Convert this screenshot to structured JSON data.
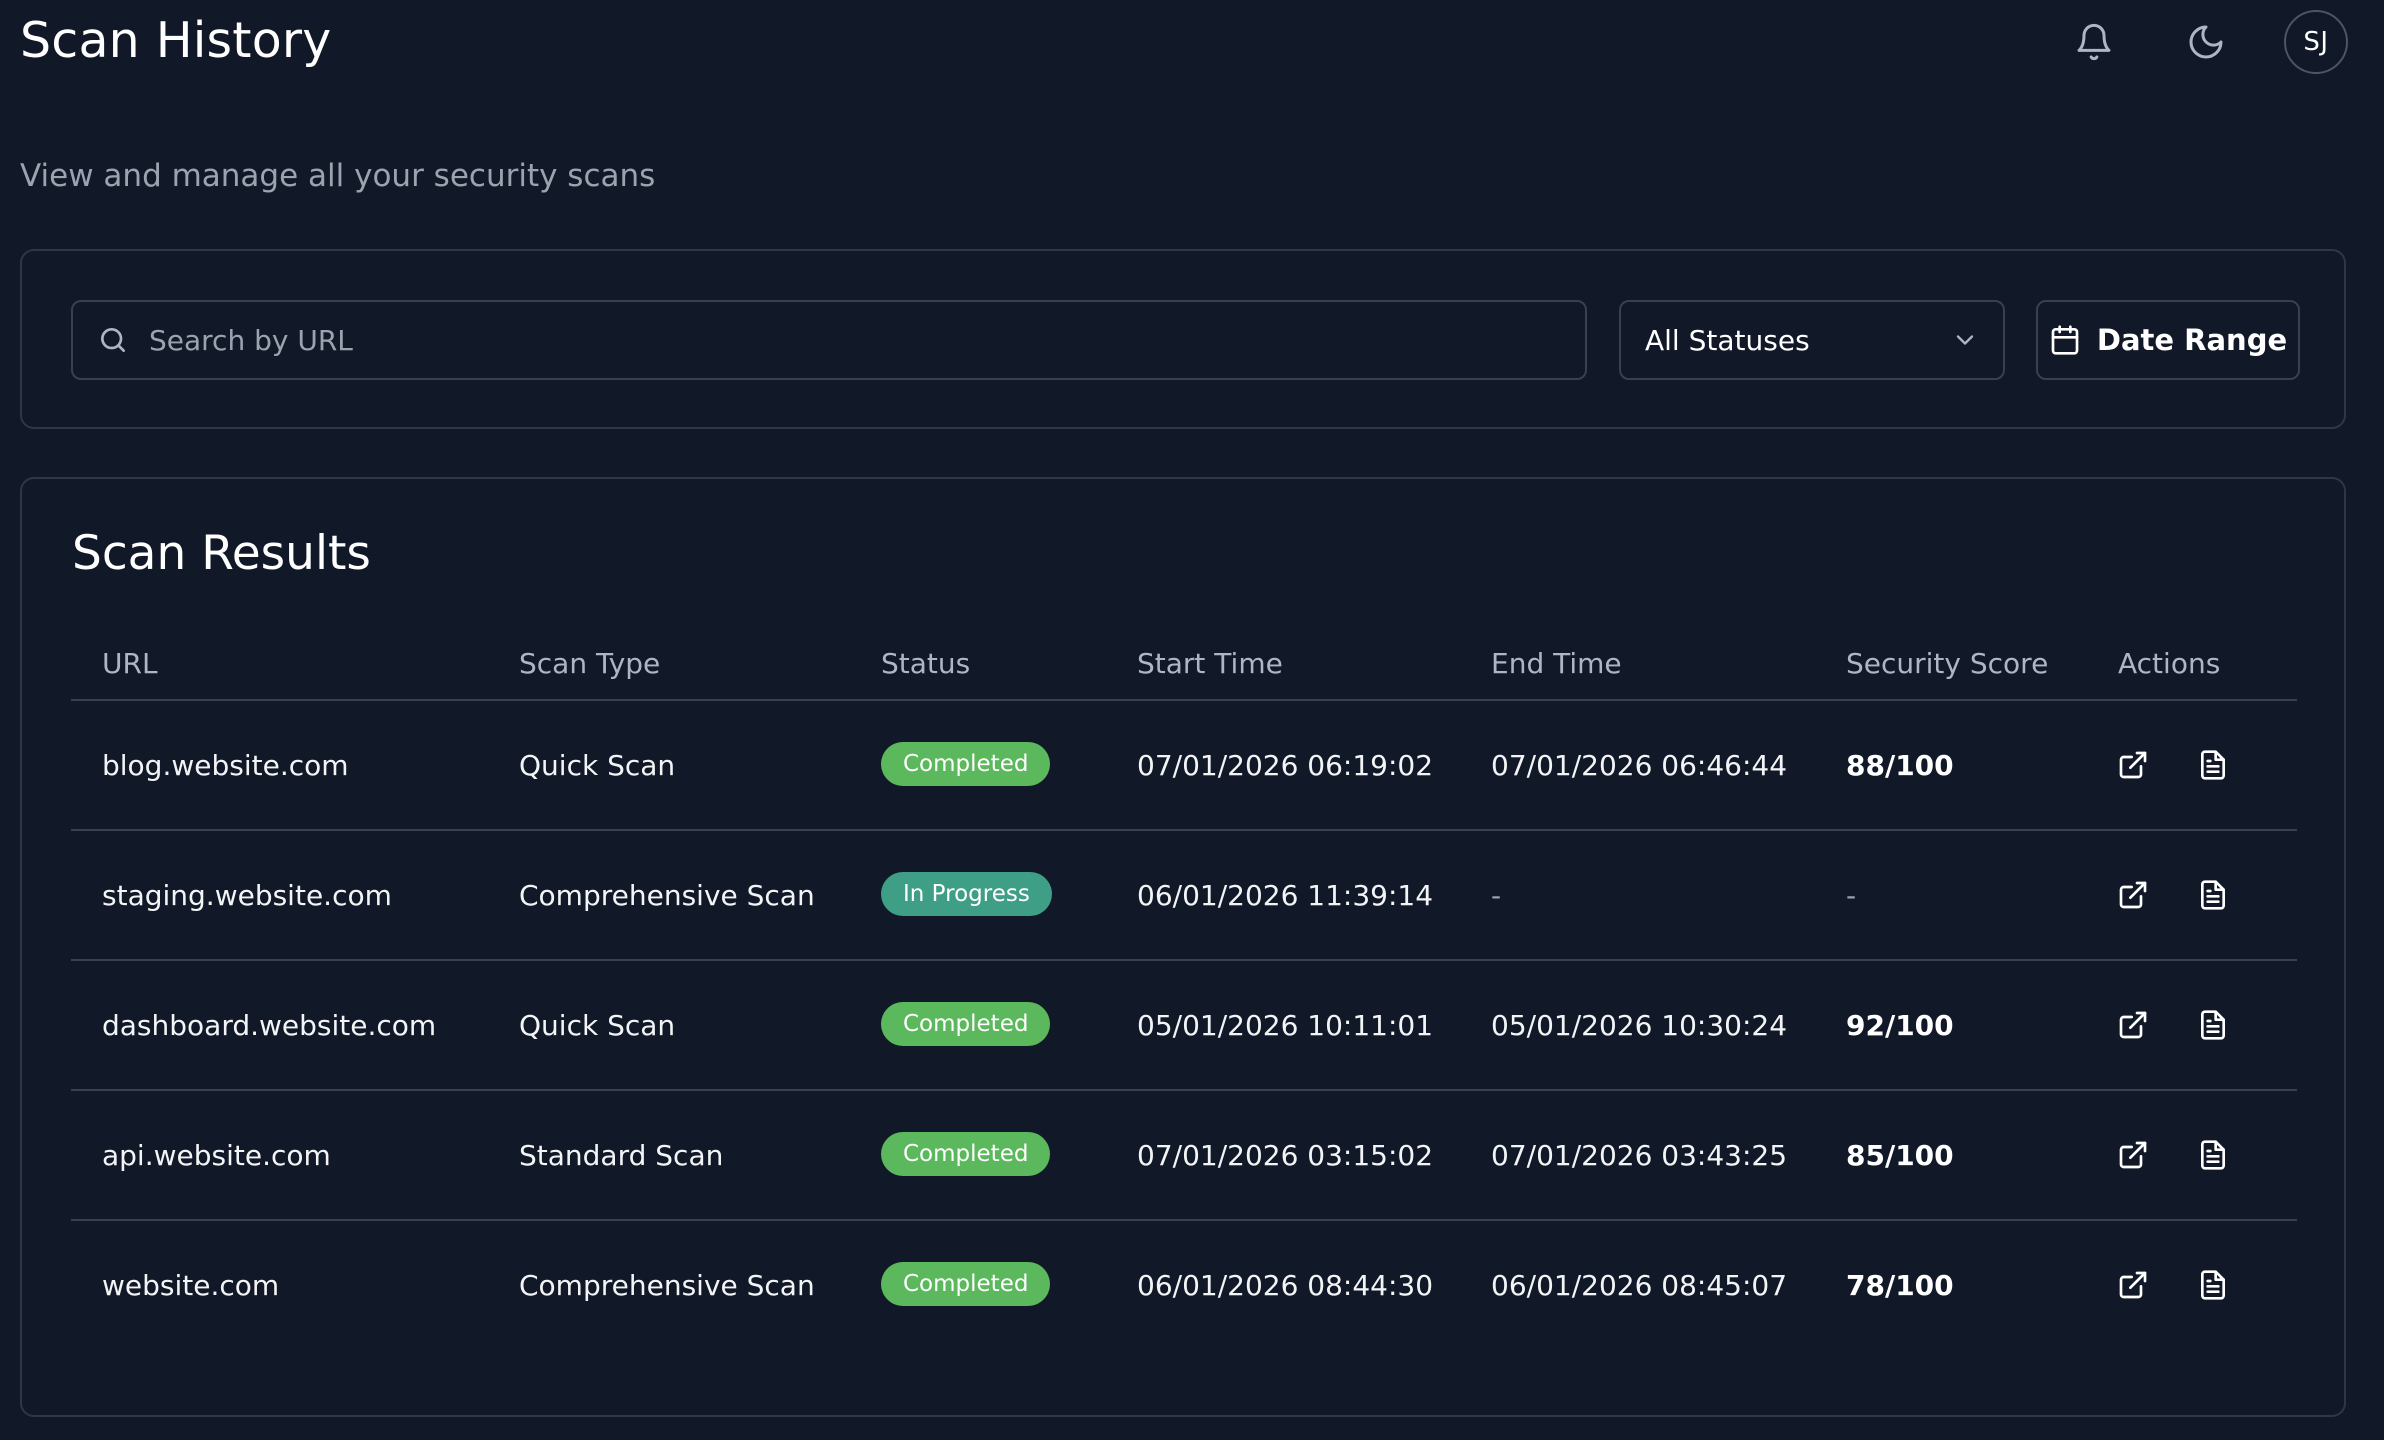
{
  "header": {
    "title": "Scan History",
    "subtitle": "View and manage all your security scans",
    "avatar_initials": "SJ",
    "icons": [
      "bell-icon",
      "moon-icon"
    ]
  },
  "filters": {
    "search_placeholder": "Search by URL",
    "search_value": "",
    "status_selected": "All Statuses",
    "date_range_label": "Date Range"
  },
  "results": {
    "title": "Scan Results",
    "columns": {
      "url": "URL",
      "scan_type": "Scan Type",
      "status": "Status",
      "start_time": "Start Time",
      "end_time": "End Time",
      "security_score": "Security Score",
      "actions": "Actions"
    },
    "rows": [
      {
        "url": "blog.website.com",
        "scan_type": "Quick Scan",
        "status": "Completed",
        "start_time": "07/01/2026 06:19:02",
        "end_time": "07/01/2026 06:46:44",
        "score": "88/100"
      },
      {
        "url": "staging.website.com",
        "scan_type": "Comprehensive Scan",
        "status": "In Progress",
        "start_time": "06/01/2026 11:39:14",
        "end_time": "-",
        "score": "-"
      },
      {
        "url": "dashboard.website.com",
        "scan_type": "Quick Scan",
        "status": "Completed",
        "start_time": "05/01/2026 10:11:01",
        "end_time": "05/01/2026 10:30:24",
        "score": "92/100"
      },
      {
        "url": "api.website.com",
        "scan_type": "Standard Scan",
        "status": "Completed",
        "start_time": "07/01/2026 03:15:02",
        "end_time": "07/01/2026 03:43:25",
        "score": "85/100"
      },
      {
        "url": "website.com",
        "scan_type": "Comprehensive Scan",
        "status": "Completed",
        "start_time": "06/01/2026 08:44:30",
        "end_time": "06/01/2026 08:45:07",
        "score": "78/100"
      }
    ]
  },
  "colors": {
    "background": "#111827",
    "card_border": "#2f3747",
    "completed_badge": "#5cb85c",
    "in_progress_badge": "#3f9e86",
    "muted_text": "#9ca3af"
  }
}
